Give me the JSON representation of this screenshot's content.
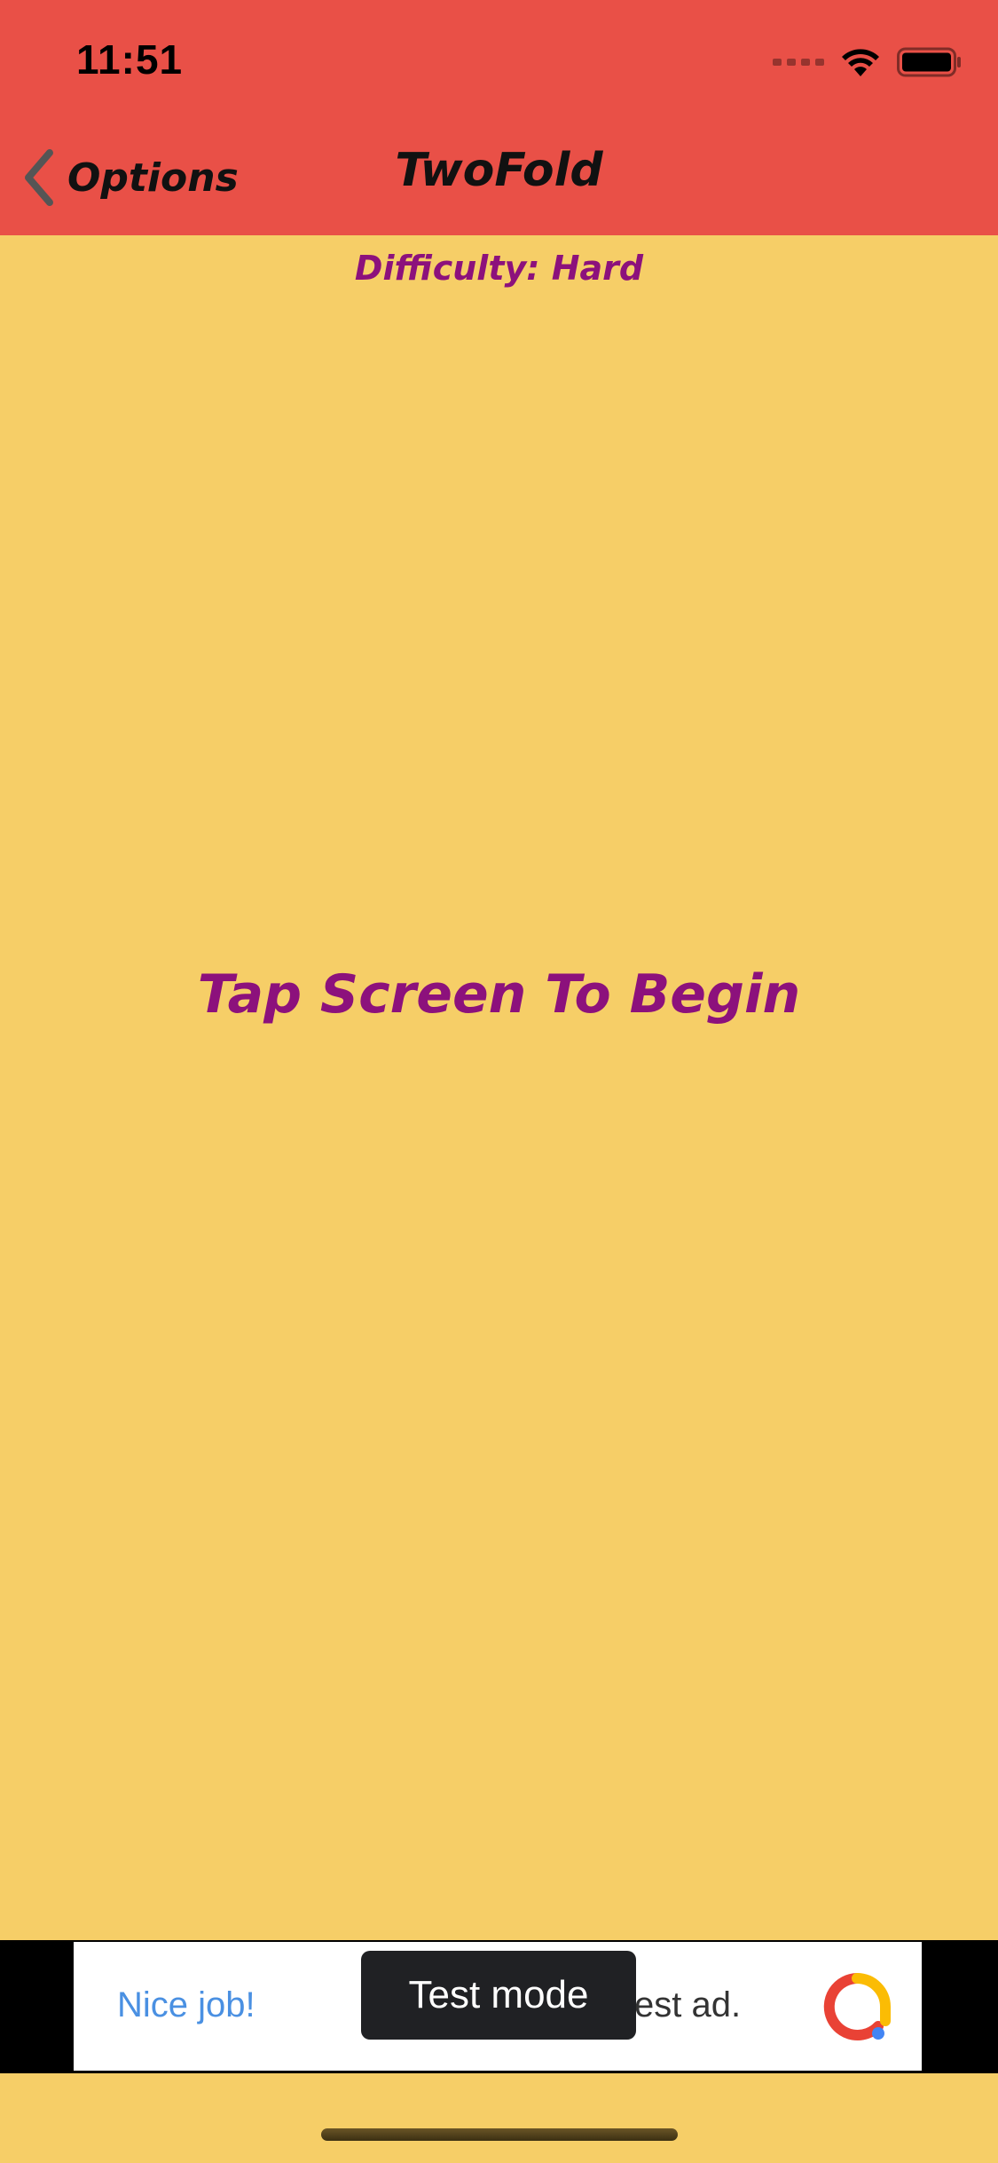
{
  "status_bar": {
    "time": "11:51"
  },
  "nav": {
    "back_label": "Options",
    "title": "TwoFold"
  },
  "game": {
    "difficulty": "Difficulty: Hard",
    "prompt": "Tap Screen To Begin"
  },
  "ad": {
    "headline": "Nice job!",
    "body_fragment": "est ad.",
    "badge": "Test mode"
  },
  "colors": {
    "header": "#E95047",
    "background": "#F6CE67",
    "accent_text": "#8C117C"
  }
}
